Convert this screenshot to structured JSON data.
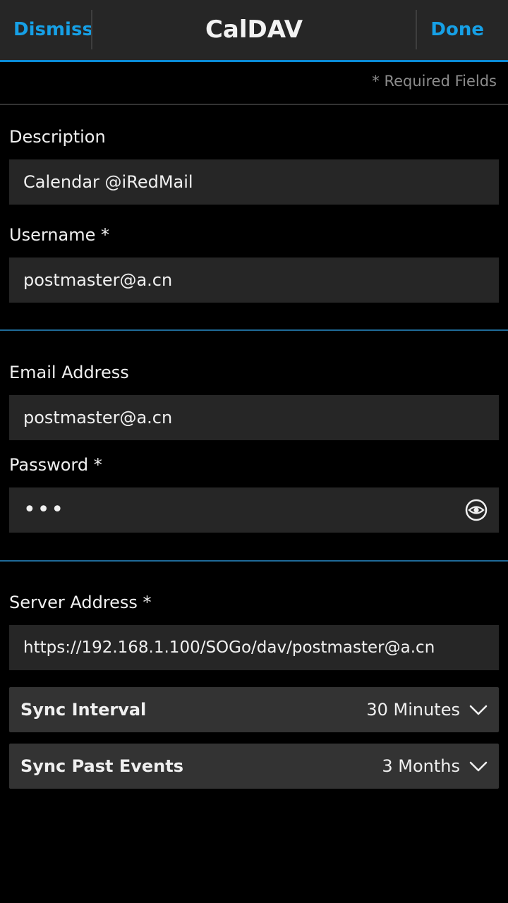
{
  "header": {
    "dismiss_label": "Dismiss",
    "title": "CalDAV",
    "done_label": "Done"
  },
  "required_note": "* Required Fields",
  "fields": {
    "description": {
      "label": "Description",
      "value": "Calendar @iRedMail"
    },
    "username": {
      "label": "Username *",
      "value": "postmaster@a.cn"
    },
    "email": {
      "label": "Email Address",
      "value": "postmaster@a.cn"
    },
    "password": {
      "label": "Password *",
      "value": "•••"
    },
    "server": {
      "label": "Server Address *",
      "value": "https://192.168.1.100/SOGo/dav/postmaster@a.cn"
    }
  },
  "dropdowns": {
    "sync_interval": {
      "label": "Sync Interval",
      "value": "30 Minutes"
    },
    "sync_past_events": {
      "label": "Sync Past Events",
      "value": "3 Months"
    }
  },
  "icons": {
    "password_toggle": "eye-icon",
    "dropdown": "chevron-down-icon"
  },
  "colors": {
    "accent": "#16a0e6",
    "background": "#000000",
    "field_bg": "#262626",
    "dropdown_bg": "#333333"
  }
}
